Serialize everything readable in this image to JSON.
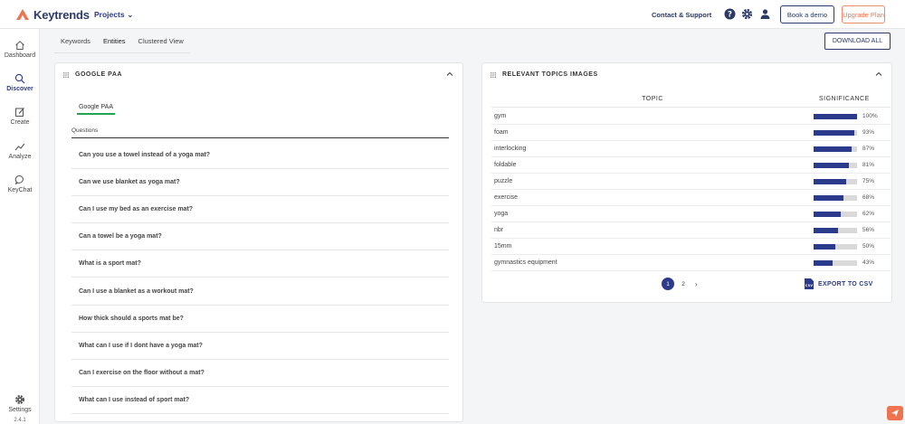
{
  "brand": {
    "name": "Keytrends",
    "accent": "#f0734f",
    "primary": "#2b3a8a"
  },
  "header": {
    "projects_label": "Projects",
    "contact_label": "Contact & Support",
    "book_demo_label": "Book a demo",
    "upgrade_label": "Upgrade Plan",
    "icons": [
      "help-icon",
      "gear-icon",
      "user-icon"
    ]
  },
  "sidebar": {
    "items": [
      {
        "label": "Dashboard",
        "icon": "home-icon"
      },
      {
        "label": "Discover",
        "icon": "search-icon",
        "active": true
      },
      {
        "label": "Create",
        "icon": "edit-icon"
      },
      {
        "label": "Analyze",
        "icon": "trend-icon"
      },
      {
        "label": "KeyChat",
        "icon": "chat-icon"
      }
    ],
    "settings_label": "Settings",
    "version": "2.4.1"
  },
  "tabs": [
    {
      "label": "Keywords"
    },
    {
      "label": "Entities",
      "active": true
    },
    {
      "label": "Clustered View"
    }
  ],
  "download_all_label": "DOWNLOAD ALL",
  "paa_panel": {
    "title": "GOOGLE PAA",
    "subtab": "Google PAA",
    "column_header": "Questions",
    "questions": [
      "Can you use a towel instead of a yoga mat?",
      "Can we use blanket as yoga mat?",
      "Can I use my bed as an exercise mat?",
      "Can a towel be a yoga mat?",
      "What is a sport mat?",
      "Can I use a blanket as a workout mat?",
      "How thick should a sports mat be?",
      "What can I use if I dont have a yoga mat?",
      "Can I exercise on the floor without a mat?",
      "What can I use instead of sport mat?"
    ]
  },
  "topics_panel": {
    "title": "RELEVANT TOPICS IMAGES",
    "col_topic": "TOPIC",
    "col_significance": "SIGNIFICANCE",
    "rows": [
      {
        "topic": "gym",
        "pct": "100%",
        "value": 100
      },
      {
        "topic": "foam",
        "pct": "93%",
        "value": 93
      },
      {
        "topic": "interlocking",
        "pct": "87%",
        "value": 87
      },
      {
        "topic": "foldable",
        "pct": "81%",
        "value": 81
      },
      {
        "topic": "puzzle",
        "pct": "75%",
        "value": 75
      },
      {
        "topic": "exercise",
        "pct": "68%",
        "value": 68
      },
      {
        "topic": "yoga",
        "pct": "62%",
        "value": 62
      },
      {
        "topic": "nbr",
        "pct": "56%",
        "value": 56
      },
      {
        "topic": "15mm",
        "pct": "50%",
        "value": 50
      },
      {
        "topic": "gymnastics equipment",
        "pct": "43%",
        "value": 43
      }
    ],
    "pages": [
      "1",
      "2"
    ],
    "current_page": "1",
    "export_label": "EXPORT TO CSV"
  }
}
